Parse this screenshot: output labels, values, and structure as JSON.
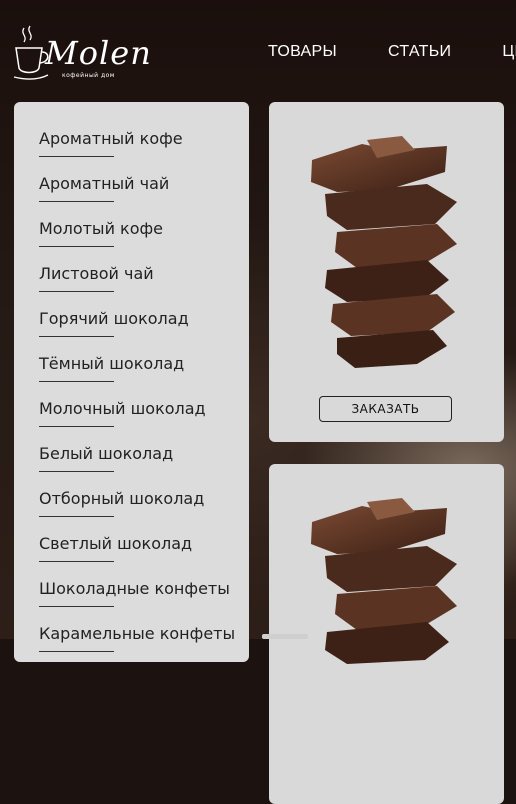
{
  "logo": {
    "word": "Molen",
    "tagline": "кофейный дом",
    "icon": "coffee-cup-icon"
  },
  "nav": [
    {
      "label": "ТОВАРЫ"
    },
    {
      "label": "СТАТЬИ"
    },
    {
      "label": "ЦЕ"
    }
  ],
  "sidebar": {
    "items": [
      {
        "label": "Ароматный кофе"
      },
      {
        "label": "Ароматный чай"
      },
      {
        "label": "Молотый кофе"
      },
      {
        "label": "Листовой чай"
      },
      {
        "label": "Горячий шоколад"
      },
      {
        "label": "Тёмный шоколад"
      },
      {
        "label": "Молочный шоколад"
      },
      {
        "label": "Белый шоколад"
      },
      {
        "label": "Отборный шоколад"
      },
      {
        "label": "Светлый шоколад"
      },
      {
        "label": "Шоколадные конфеты"
      },
      {
        "label": "Карамельные конфеты"
      }
    ]
  },
  "products": [
    {
      "image": "chocolate-stack",
      "button": "ЗАКАЗАТЬ"
    },
    {
      "image": "chocolate-stack"
    }
  ],
  "colors": {
    "panel": "#dcdcdc",
    "header_text": "#ffffff",
    "chocolate": "#4a2a1c"
  }
}
